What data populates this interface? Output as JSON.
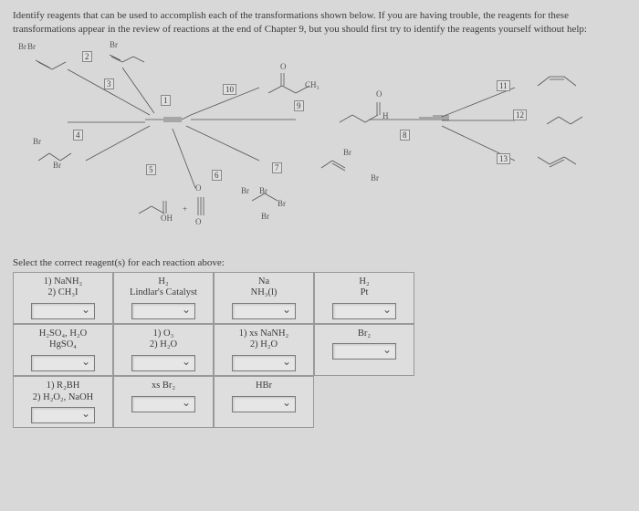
{
  "instructions": "Identify reagents that can be used to accomplish each of the transformations shown below. If you are having trouble, the reagents for these transformations appear in the review of reactions at the end of Chapter 9, but you should first try to identify the reagents yourself without help:",
  "scheme": {
    "labels": {
      "Br1": "Br",
      "Br2": "Br",
      "Br3": "Br",
      "Br4": "Br",
      "Br5": "Br",
      "Br6": "Br",
      "Br7": "Br",
      "Br8": "Br",
      "Br9": "Br",
      "Br10": "Br",
      "CH3": "CH₃",
      "H": "H",
      "OH": "OH",
      "O": "O",
      "plus": "+"
    },
    "boxes": {
      "b1": "1",
      "b2": "2",
      "b3": "3",
      "b4": "4",
      "b5": "5",
      "b6": "6",
      "b7": "7",
      "b8": "8",
      "b9": "9",
      "b10": "10",
      "b11": "11",
      "b12": "12",
      "b13": "13"
    }
  },
  "select_prompt": "Select the correct reagent(s) for each reaction above:",
  "reagents": {
    "r1": "1) NaNH₂\n2) CH₃I",
    "r2": "H₂\nLindlar's Catalyst",
    "r3": "Na\nNH₃(l)",
    "r4": "H₂\nPt",
    "r5": "H₂SO₄, H₂O\nHgSO₄",
    "r6": "1) O₃\n2) H₂O",
    "r7": "1) xs NaNH₂\n2) H₂O",
    "r8": "Br₂",
    "r9": "1) R₂BH\n2) H₂O₂, NaOH",
    "r10": "xs Br₂",
    "r11": "HBr"
  }
}
